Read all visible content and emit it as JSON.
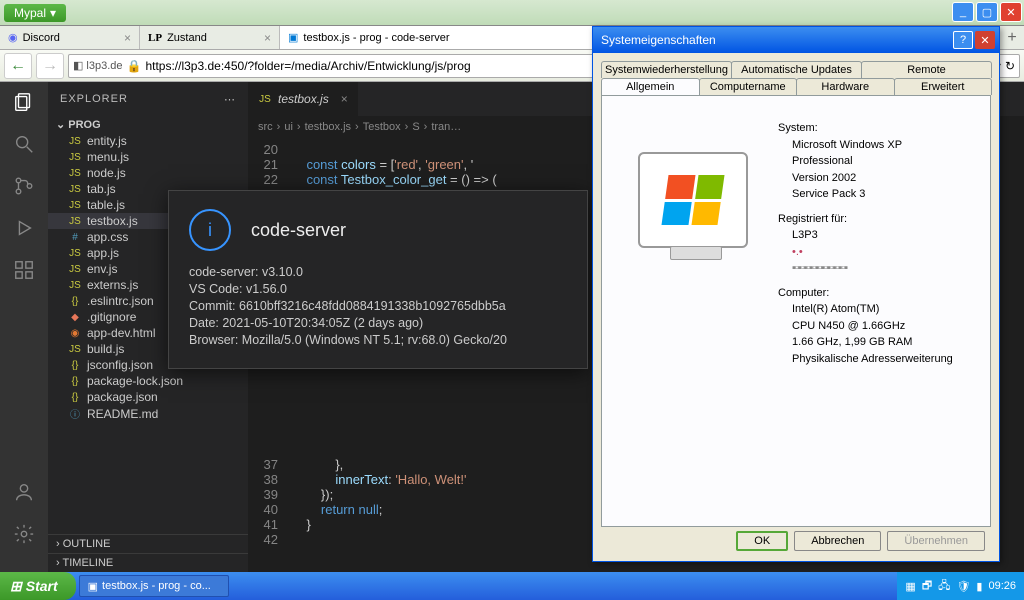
{
  "browser": {
    "app_button": "Mypal",
    "tabs": [
      {
        "label": "Discord",
        "icon": "discord"
      },
      {
        "label": "Zustand",
        "prefix": "LP"
      },
      {
        "label": "testbox.js - prog - code-server",
        "active": true
      }
    ],
    "url_identity": "l3p3.de",
    "url": "https://l3p3.de:450/?folder=/media/Archiv/Entwicklung/js/prog"
  },
  "vscode": {
    "explorer_label": "EXPLORER",
    "folder": "PROG",
    "files": [
      {
        "name": "entity.js",
        "icon": "js"
      },
      {
        "name": "menu.js",
        "icon": "js"
      },
      {
        "name": "node.js",
        "icon": "js"
      },
      {
        "name": "tab.js",
        "icon": "js"
      },
      {
        "name": "table.js",
        "icon": "js"
      },
      {
        "name": "testbox.js",
        "icon": "js",
        "selected": true
      },
      {
        "name": "app.css",
        "icon": "css"
      },
      {
        "name": "app.js",
        "icon": "js"
      },
      {
        "name": "env.js",
        "icon": "js"
      },
      {
        "name": "externs.js",
        "icon": "js"
      },
      {
        "name": ".eslintrc.json",
        "icon": "json"
      },
      {
        "name": ".gitignore",
        "icon": "git"
      },
      {
        "name": "app-dev.html",
        "icon": "html"
      },
      {
        "name": "build.js",
        "icon": "js"
      },
      {
        "name": "jsconfig.json",
        "icon": "json"
      },
      {
        "name": "package-lock.json",
        "icon": "json"
      },
      {
        "name": "package.json",
        "icon": "json"
      },
      {
        "name": "README.md",
        "icon": "md"
      }
    ],
    "outline": "OUTLINE",
    "timeline": "TIMELINE",
    "open_tab": "testbox.js",
    "breadcrumb": [
      "src",
      "ui",
      "testbox.js",
      "Testbox",
      "S",
      "tran…"
    ],
    "code": [
      {
        "n": 20,
        "t": ""
      },
      {
        "n": 21,
        "t": "    const colors = ['red', 'green', '"
      },
      {
        "n": 22,
        "t": "    const Testbox_color_get = () => ("
      },
      {
        "n": 37,
        "t": "            },"
      },
      {
        "n": 38,
        "t": "            innerText: 'Hallo, Welt!'"
      },
      {
        "n": 39,
        "t": "        });"
      },
      {
        "n": 40,
        "t": "        return null;"
      },
      {
        "n": 41,
        "t": "    }"
      },
      {
        "n": 42,
        "t": ""
      }
    ]
  },
  "about": {
    "title": "code-server",
    "lines": [
      "code-server: v3.10.0",
      "VS Code: v1.56.0",
      "Commit: 6610bff3216c48fdd0884191338b1092765dbb5a",
      "Date: 2021-05-10T20:34:05Z (2 days ago)",
      "Browser: Mozilla/5.0 (Windows NT 5.1; rv:68.0) Gecko/20"
    ]
  },
  "sysprops": {
    "title": "Systemeigenschaften",
    "tabs_top": [
      "Systemwiederherstellung",
      "Automatische Updates",
      "Remote"
    ],
    "tabs_bot": [
      "Allgemein",
      "Computername",
      "Hardware",
      "Erweitert"
    ],
    "active_tab": "Allgemein",
    "system_hdr": "System:",
    "system": [
      "Microsoft Windows XP",
      "Professional",
      "Version 2002",
      "Service Pack 3"
    ],
    "reg_hdr": "Registriert für:",
    "reg": [
      "L3P3"
    ],
    "comp_hdr": "Computer:",
    "comp": [
      "Intel(R) Atom(TM)",
      "CPU N450  @ 1.66GHz",
      "1.66 GHz, 1,99 GB RAM",
      "Physikalische Adresserweiterung"
    ],
    "ok": "OK",
    "cancel": "Abbrechen",
    "apply": "Übernehmen"
  },
  "taskbar": {
    "start": "Start",
    "task": "testbox.js - prog - co...",
    "clock": "09:26"
  }
}
